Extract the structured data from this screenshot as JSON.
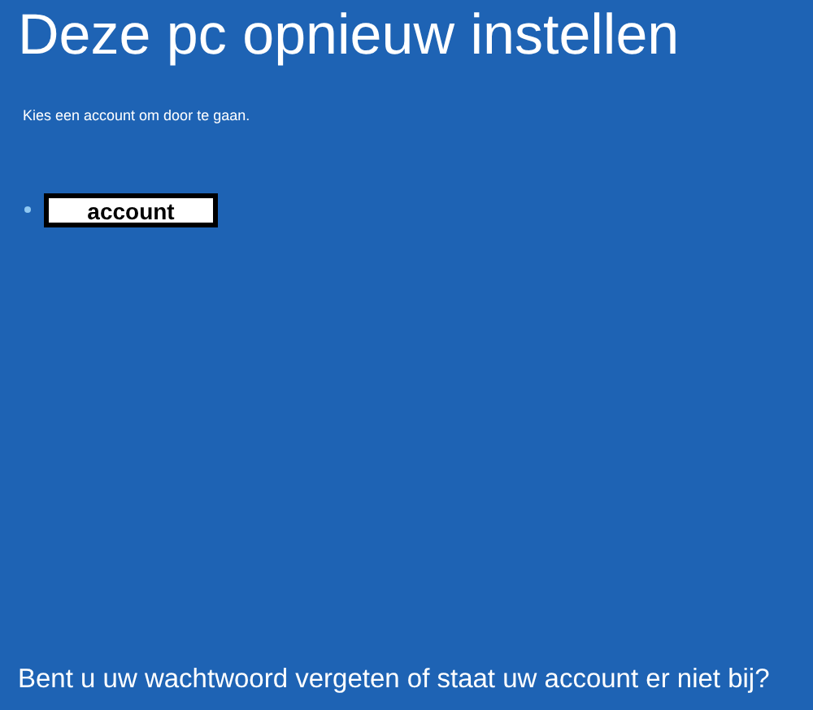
{
  "title": "Deze pc opnieuw instellen",
  "instruction": "Kies een account om door te gaan.",
  "accounts": [
    {
      "name": "account"
    }
  ],
  "footer_link": "Bent u uw wachtwoord vergeten of staat uw account er niet bij?"
}
